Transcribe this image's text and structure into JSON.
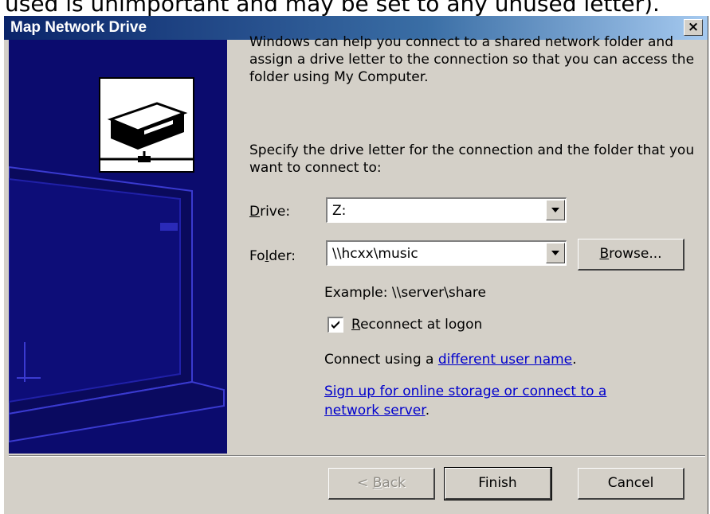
{
  "caption": "used is unimportant and may be set to any unused letter).",
  "window": {
    "title": "Map Network Drive",
    "close_glyph": "×"
  },
  "intro": "Windows can help you connect to a shared network folder and assign a drive letter to the connection so that you can access the folder using My Computer.",
  "instruction": "Specify the drive letter for the connection and the folder that you want to connect to:",
  "drive": {
    "label_pre": "",
    "label_mnemonic": "D",
    "label_post": "rive:",
    "value": "Z:"
  },
  "folder": {
    "label_pre": "Fo",
    "label_mnemonic": "l",
    "label_post": "der:",
    "value": "\\\\hcxx\\music"
  },
  "browse": {
    "mnemonic": "B",
    "rest": "rowse..."
  },
  "example": "Example: \\\\server\\share",
  "reconnect": {
    "mnemonic": "R",
    "rest": "econnect at logon",
    "checked": true
  },
  "connect_using": {
    "prefix": "Connect using a ",
    "link": "different user name",
    "suffix": "."
  },
  "signup_link_1": "Sign up for online storage or connect to a",
  "signup_link_2": "network server",
  "signup_suffix": ".",
  "buttons": {
    "back": {
      "pre": "< ",
      "mnemonic": "B",
      "rest": "ack"
    },
    "finish": "Finish",
    "cancel": "Cancel"
  },
  "icons": [
    "close-icon",
    "network-drive-icon",
    "dropdown-arrow-icon",
    "checkmark-icon"
  ],
  "colors": {
    "title_start": "#0a246a",
    "title_end": "#a6caf0",
    "dialog_bg": "#d4d0c8",
    "art_bg": "#0b0b6e",
    "link": "#0000cc"
  }
}
